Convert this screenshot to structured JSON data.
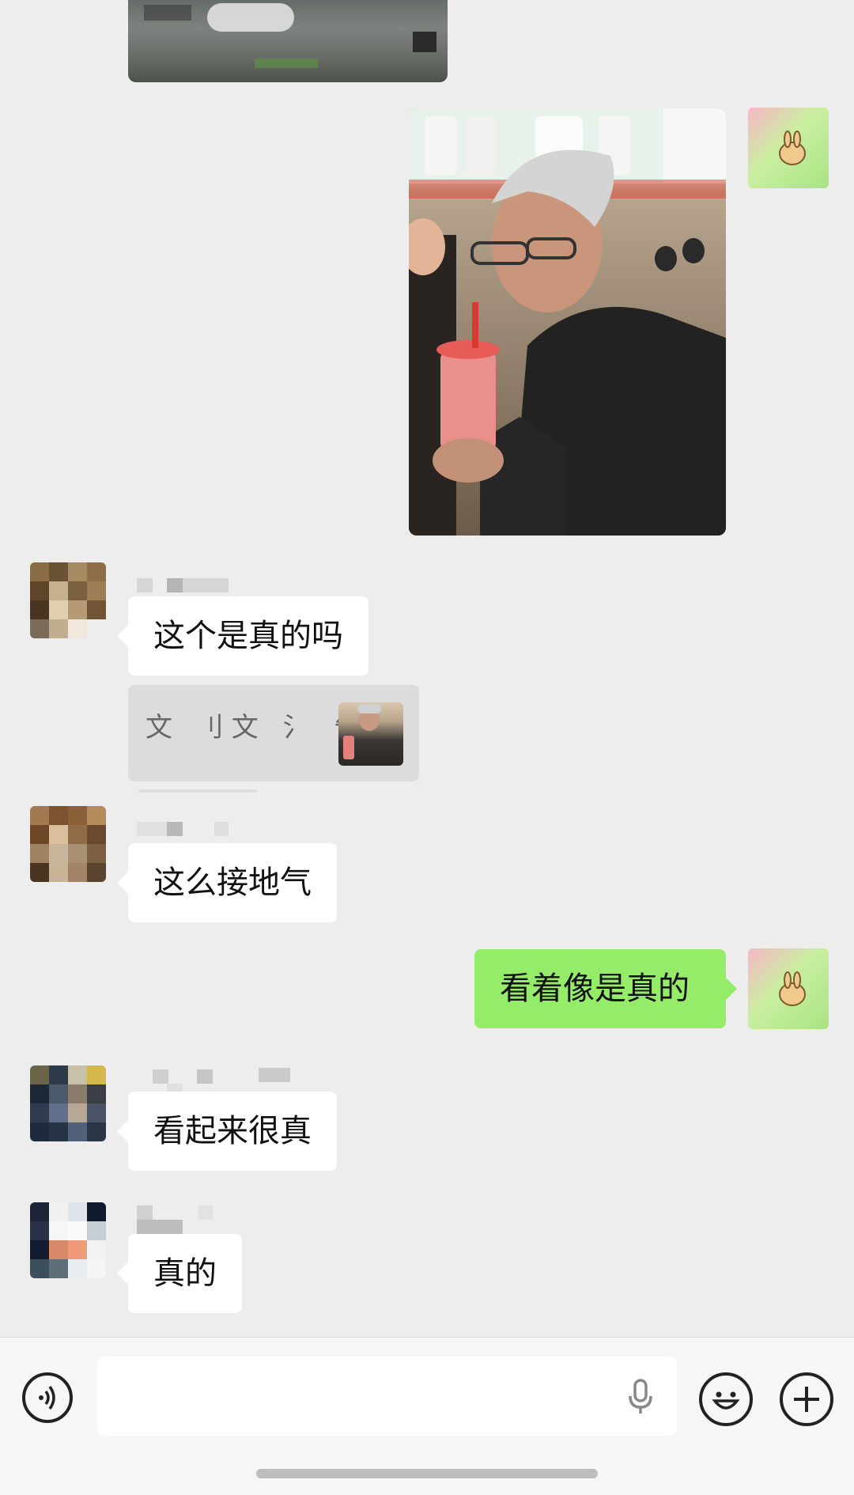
{
  "messages": [
    {
      "id": "m1",
      "type": "image",
      "side": "left",
      "alt": ""
    },
    {
      "id": "m2",
      "type": "image",
      "side": "right",
      "alt": ""
    },
    {
      "id": "m3",
      "type": "text",
      "side": "left",
      "text": "这个是真的吗"
    },
    {
      "id": "m4",
      "type": "quote",
      "side": "left",
      "text": "文 刂文 氵 告:"
    },
    {
      "id": "m5",
      "type": "text",
      "side": "left",
      "text": "这么接地气"
    },
    {
      "id": "m6",
      "type": "text",
      "side": "right",
      "text": "看着像是真的"
    },
    {
      "id": "m7",
      "type": "text",
      "side": "left",
      "text": "看起来很真"
    },
    {
      "id": "m8",
      "type": "text",
      "side": "left",
      "text": "真的"
    }
  ],
  "input_bar": {
    "voice_icon": "voice-icon",
    "mic_icon": "microphone-icon",
    "emoji_icon": "emoji-icon",
    "plus_icon": "plus-icon",
    "text_value": ""
  },
  "colors": {
    "background": "#ededed",
    "bubble_incoming": "#ffffff",
    "bubble_outgoing": "#95ec69",
    "quote_background": "#dcdcdc"
  }
}
